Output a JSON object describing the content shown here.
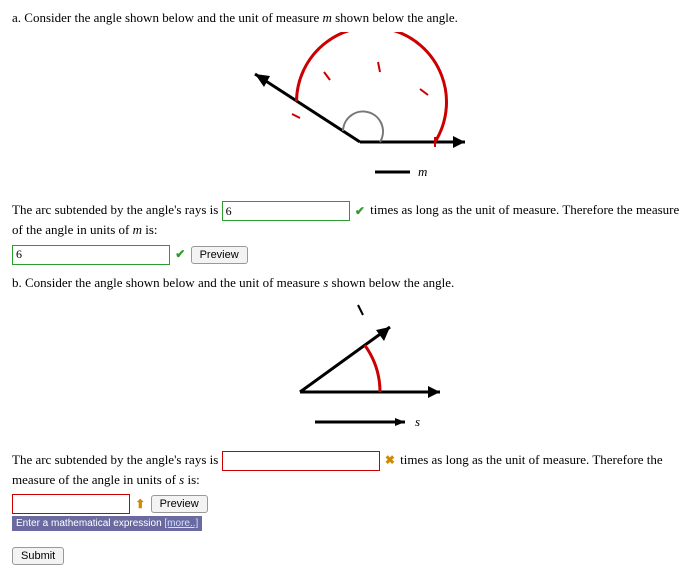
{
  "partA": {
    "prompt_prefix": "a. Consider the angle shown below and the unit of measure ",
    "prompt_unit": "m",
    "prompt_suffix": " shown below the angle.",
    "line1_before": "The arc subtended by the angle's rays is ",
    "input1_value": "6",
    "line1_after": " times as long as the unit of measure. Therefore the measure of the angle in units of ",
    "line1_unit": "m",
    "line1_end": " is:",
    "input2_value": "6",
    "preview_label": "Preview",
    "fig_unit_label": "m"
  },
  "partB": {
    "prompt_prefix": "b. Consider the angle shown below and the unit of measure ",
    "prompt_unit": "s",
    "prompt_suffix": " shown below the angle.",
    "line1_before": "The arc subtended by the angle's rays is ",
    "input1_value": "",
    "line1_after": " times as long as the unit of measure. Therefore the measure of the angle in units of ",
    "line1_unit": "s",
    "line1_end": " is:",
    "input2_value": "",
    "preview_label": "Preview",
    "hint_text": "Enter a mathematical expression ",
    "hint_more": "[more..]",
    "fig_unit_label": "s"
  },
  "submit_label": "Submit"
}
